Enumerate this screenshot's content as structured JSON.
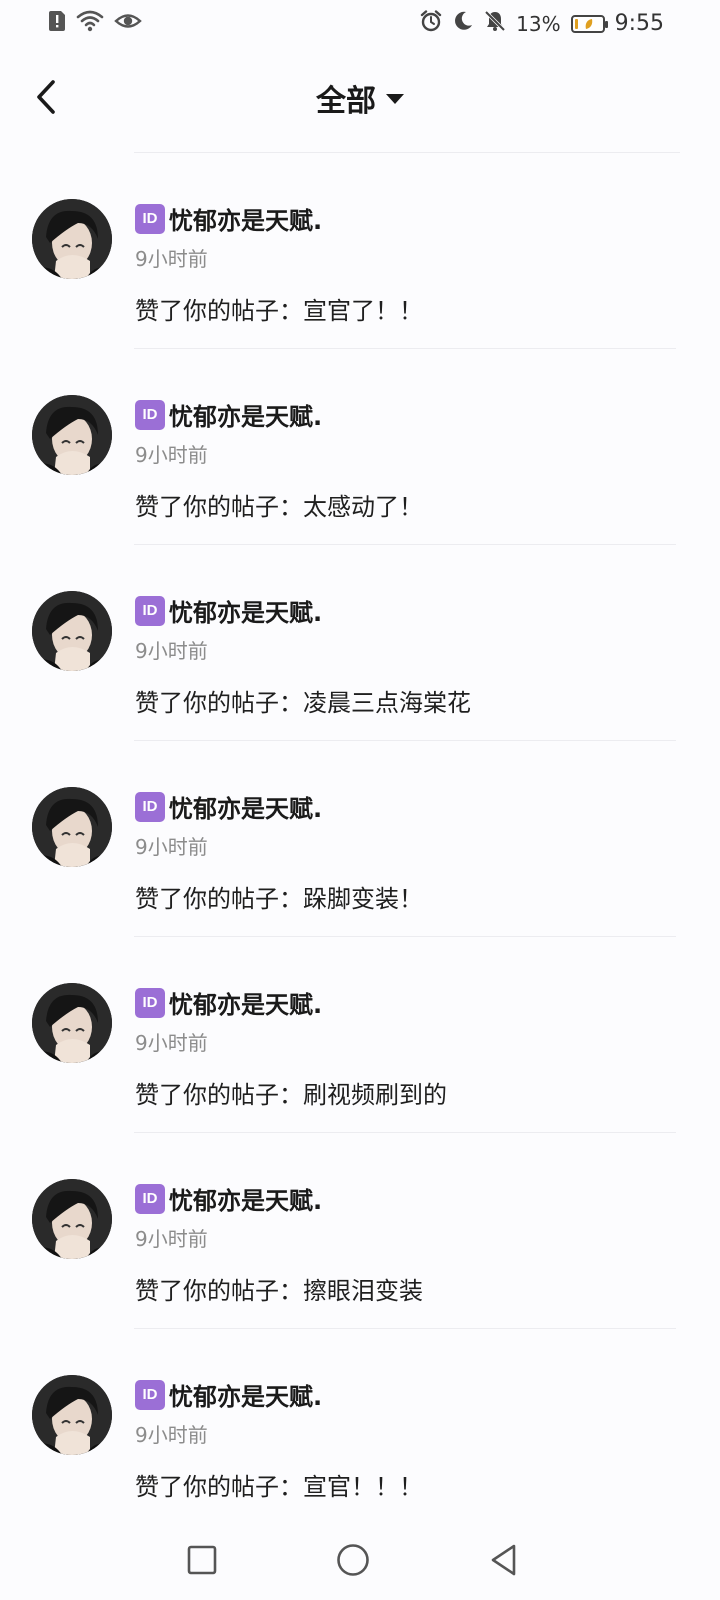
{
  "status_bar": {
    "time": "9:55",
    "battery_percent": "13%",
    "battery_fill_fraction": 0.13,
    "left_icons": [
      "alert-card-icon",
      "wifi-icon",
      "eye-icon"
    ],
    "right_icons": [
      "alarm-icon",
      "moon-icon",
      "bell-off-icon",
      "battery-icon"
    ]
  },
  "header": {
    "title": "全部",
    "back_icon": "chevron-left-icon",
    "dropdown_icon": "caret-down-icon"
  },
  "notifications": [
    {
      "badge": "ID",
      "name": "忧郁亦是天赋.",
      "time": "9小时前",
      "message": "赞了你的帖子：宣官了！！"
    },
    {
      "badge": "ID",
      "name": "忧郁亦是天赋.",
      "time": "9小时前",
      "message": "赞了你的帖子：太感动了！"
    },
    {
      "badge": "ID",
      "name": "忧郁亦是天赋.",
      "time": "9小时前",
      "message": "赞了你的帖子：凌晨三点海棠花"
    },
    {
      "badge": "ID",
      "name": "忧郁亦是天赋.",
      "time": "9小时前",
      "message": "赞了你的帖子：跺脚变装！"
    },
    {
      "badge": "ID",
      "name": "忧郁亦是天赋.",
      "time": "9小时前",
      "message": "赞了你的帖子：刷视频刷到的"
    },
    {
      "badge": "ID",
      "name": "忧郁亦是天赋.",
      "time": "9小时前",
      "message": "赞了你的帖子：擦眼泪变装"
    },
    {
      "badge": "ID",
      "name": "忧郁亦是天赋.",
      "time": "9小时前",
      "message": "赞了你的帖子：宣官！！！"
    }
  ],
  "nav_bar": {
    "icons": [
      "square-recents-icon",
      "circle-home-icon",
      "triangle-back-icon"
    ]
  },
  "colors": {
    "background": "#fcfcfe",
    "badge": "#9b6fd6",
    "secondary_text": "#8c8c8c",
    "divider": "#ececf0"
  }
}
